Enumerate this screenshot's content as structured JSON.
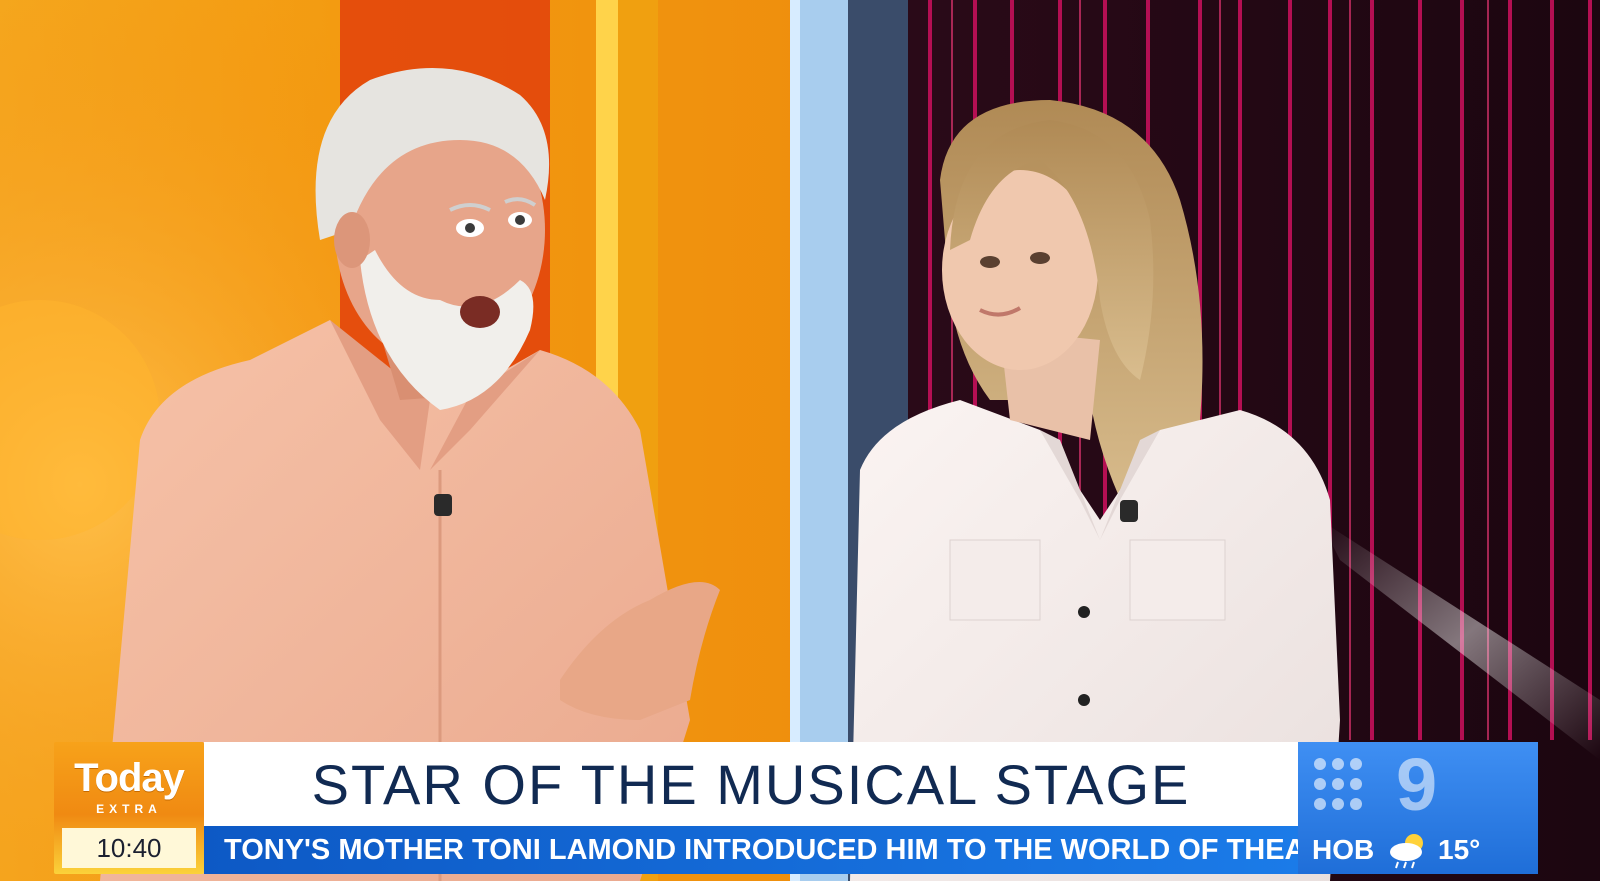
{
  "broadcast": {
    "show_name": "Today",
    "show_sub": "EXTRA",
    "time": "10:40",
    "headline": "STAR OF THE MUSICAL STAGE",
    "subline": "TONY'S MOTHER TONI LAMOND INTRODUCED HIM TO THE WORLD OF THEATRE",
    "network_logo": "9",
    "weather": {
      "location": "HOB",
      "icon": "partly-cloudy-rain-icon",
      "temperature": "15°"
    }
  },
  "colors": {
    "set_orange": "#f29a12",
    "set_blue": "#a8cdee",
    "curtain_red": "#c4105a",
    "headline_text": "#112a52",
    "subline_bar": "#1466d6",
    "network_blue": "#2a7fe6",
    "logo_orange": "#f7a21a"
  }
}
